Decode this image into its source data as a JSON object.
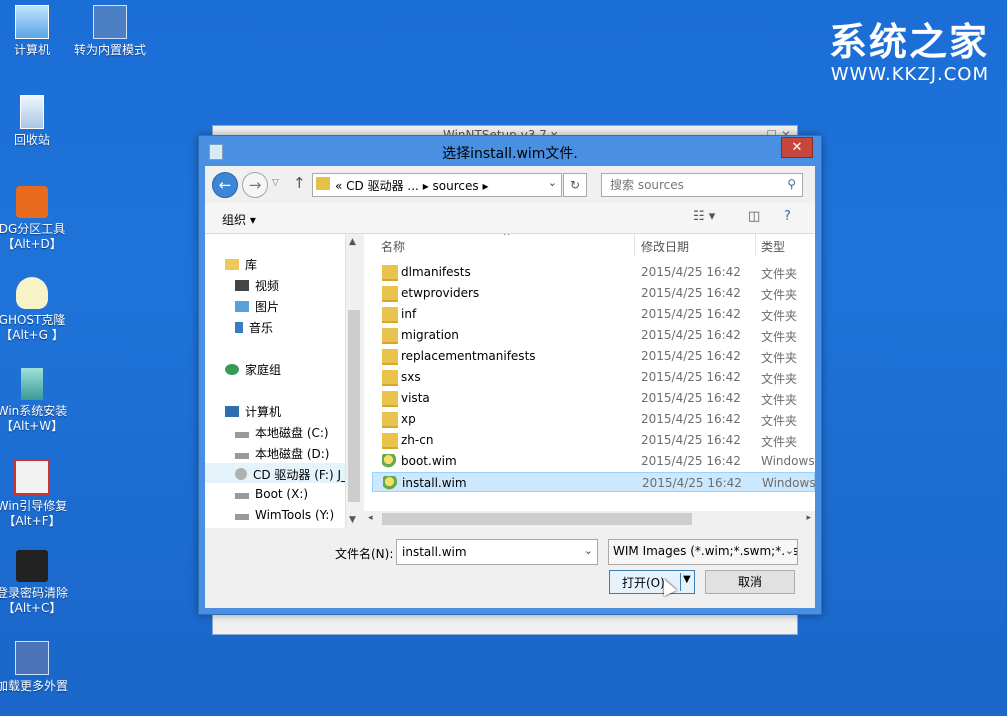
{
  "desktop": {
    "icons": [
      {
        "label": "计算机",
        "icon": "computer-icon"
      },
      {
        "label": "转为内置模式",
        "icon": "shortcut-icon"
      },
      {
        "label": "回收站",
        "icon": "recycle-bin-icon"
      },
      {
        "label": "DG分区工具",
        "sub": "【Alt+D】",
        "icon": "diskgenius-icon"
      },
      {
        "label": "GHOST克隆",
        "sub": "【Alt+G 】",
        "icon": "ghost-icon"
      },
      {
        "label": "Win系统安装",
        "sub": "【Alt+W】",
        "icon": "install-icon"
      },
      {
        "label": "Win引导修复",
        "sub": "【Alt+F】",
        "icon": "boot-repair-icon"
      },
      {
        "label": "登录密码清除",
        "sub": "【Alt+C】",
        "icon": "password-clear-icon"
      },
      {
        "label": "加载更多外置",
        "icon": "load-more-icon"
      }
    ],
    "brand": {
      "name": "系统之家",
      "url": "WWW.KKZJ.COM"
    }
  },
  "back_window": {
    "title": "WinNTSetup v3.7.x"
  },
  "dialog": {
    "title": "选择install.wim文件.",
    "close_label": "✕",
    "address": {
      "crumbs": [
        "«",
        "CD 驱动器 ...",
        "sources"
      ]
    },
    "search_placeholder": "搜索 sources",
    "toolbar": {
      "organize": "组织"
    },
    "nav": {
      "library": "库",
      "library_items": [
        "视频",
        "图片",
        "音乐"
      ],
      "homegroup": "家庭组",
      "computer": "计算机",
      "drives": [
        "本地磁盘 (C:)",
        "本地磁盘 (D:)",
        "CD 驱动器 (F:) J_",
        "Boot (X:)",
        "WimTools (Y:)"
      ]
    },
    "columns": {
      "name": "名称",
      "date": "修改日期",
      "type": "类型"
    },
    "files": [
      {
        "name": "dlmanifests",
        "date": "2015/4/25 16:42",
        "type": "文件夹",
        "kind": "folder"
      },
      {
        "name": "etwproviders",
        "date": "2015/4/25 16:42",
        "type": "文件夹",
        "kind": "folder"
      },
      {
        "name": "inf",
        "date": "2015/4/25 16:42",
        "type": "文件夹",
        "kind": "folder"
      },
      {
        "name": "migration",
        "date": "2015/4/25 16:42",
        "type": "文件夹",
        "kind": "folder"
      },
      {
        "name": "replacementmanifests",
        "date": "2015/4/25 16:42",
        "type": "文件夹",
        "kind": "folder"
      },
      {
        "name": "sxs",
        "date": "2015/4/25 16:42",
        "type": "文件夹",
        "kind": "folder"
      },
      {
        "name": "vista",
        "date": "2015/4/25 16:42",
        "type": "文件夹",
        "kind": "folder"
      },
      {
        "name": "xp",
        "date": "2015/4/25 16:42",
        "type": "文件夹",
        "kind": "folder"
      },
      {
        "name": "zh-cn",
        "date": "2015/4/25 16:42",
        "type": "文件夹",
        "kind": "folder"
      },
      {
        "name": "boot.wim",
        "date": "2015/4/25 16:42",
        "type": "Windows",
        "kind": "wim"
      },
      {
        "name": "install.wim",
        "date": "2015/4/25 16:42",
        "type": "Windows",
        "kind": "wim",
        "selected": true
      }
    ],
    "footer": {
      "filename_label": "文件名(N):",
      "filename_value": "install.wim",
      "filetype_value": "WIM Images (*.wim;*.swm;*.esd)",
      "open_label": "打开(O)",
      "cancel_label": "取消"
    }
  },
  "colors": {
    "desktop": "#1f73d8",
    "selection": "#cce8ff",
    "close": "#c7463b"
  }
}
